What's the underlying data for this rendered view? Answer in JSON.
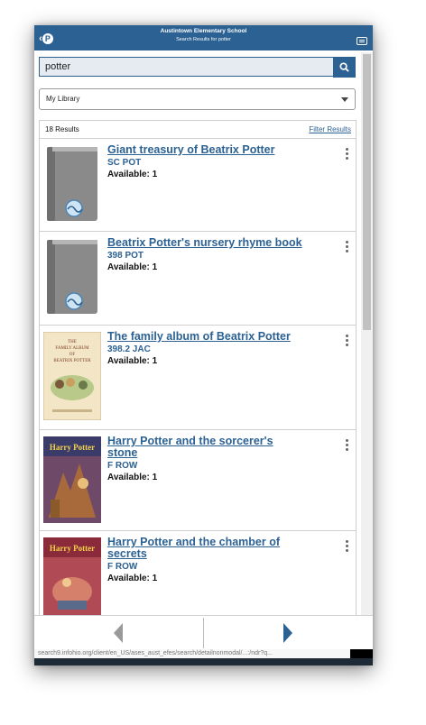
{
  "header": {
    "school": "Austintown Elementary School",
    "subtitle": "Search Results for potter"
  },
  "search": {
    "value": "potter"
  },
  "library_select": {
    "selected": "My Library"
  },
  "results_bar": {
    "count": "18 Results",
    "filter_label": "Filter Results"
  },
  "results": [
    {
      "title": "Giant treasury of Beatrix Potter",
      "call_number": "SC POT",
      "availability": "Available: 1",
      "cover": "generic-book-icon"
    },
    {
      "title": "Beatrix Potter's nursery rhyme book",
      "call_number": "398 POT",
      "availability": "Available: 1",
      "cover": "generic-book-icon"
    },
    {
      "title": "The family album of Beatrix Potter",
      "call_number": "398.2 JAC",
      "availability": "Available: 1",
      "cover": "book-cover",
      "cover_text": [
        "THE",
        "FAMILY ALBUM",
        "OF",
        "BEATRIX POTTER"
      ]
    },
    {
      "title": "Harry Potter and the sorcerer's stone",
      "call_number": "F ROW",
      "availability": "Available: 1",
      "cover": "book-cover",
      "cover_text": [
        "Harry Potter"
      ]
    },
    {
      "title": "Harry Potter and the chamber of secrets",
      "call_number": "F ROW",
      "availability": "Available: 1",
      "cover": "book-cover",
      "cover_text": [
        "Harry Potter"
      ]
    }
  ],
  "status_url": "search9.infohio.org/client/en_US/ases_aust_efes/search/detailnonmodal/...:/ndr?q...",
  "colors": {
    "brand": "#2c6193",
    "link": "#2c6193"
  }
}
